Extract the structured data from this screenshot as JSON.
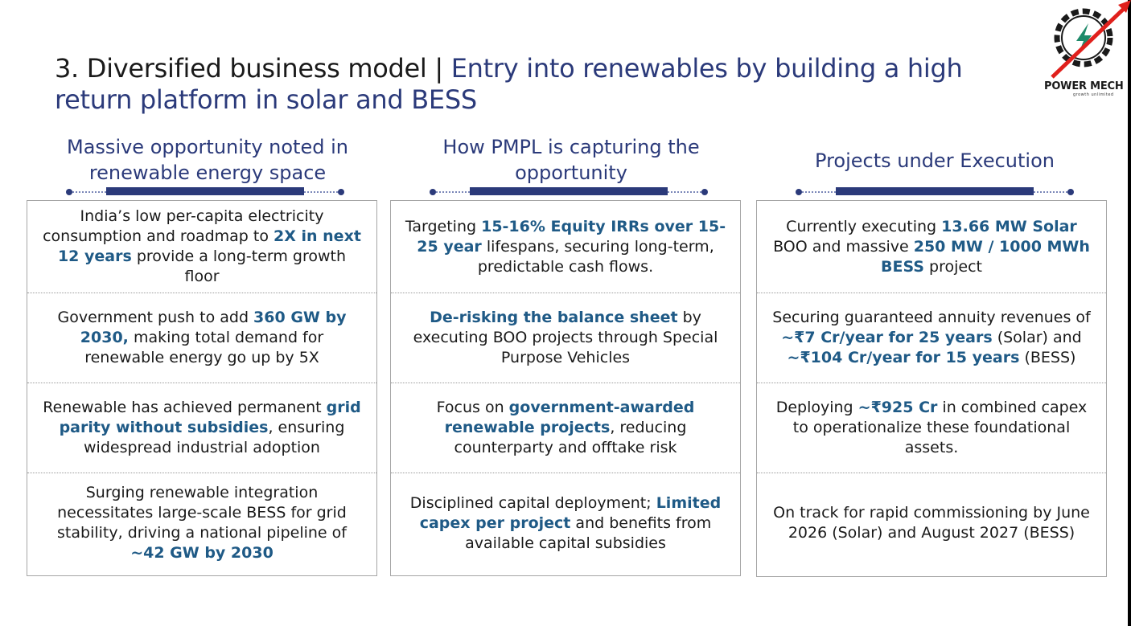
{
  "title": {
    "prefix": "3. Diversified business model",
    "separator": " | ",
    "main": "Entry into renewables by building a high return platform in solar and BESS"
  },
  "logo": {
    "icon": "gear-lightning-arrow-icon",
    "name": "POWER MECH",
    "tagline": "growth unlimited",
    "colors": {
      "gear": "#1a1a1a",
      "bolt": "#1f8a6a",
      "arrow": "#e0201c"
    }
  },
  "colors": {
    "accent": "#2b3a7a",
    "highlight": "#1f5a86",
    "border": "#a6a6a6"
  },
  "columns": [
    {
      "heading": "Massive opportunity noted in renewable energy space",
      "items": [
        [
          {
            "t": "India’s low per-capita electricity consumption and roadmap to "
          },
          {
            "t": "2X in next 12 years",
            "h": true
          },
          {
            "t": " provide a long-term growth floor"
          }
        ],
        [
          {
            "t": "Government push to add "
          },
          {
            "t": "360 GW by 2030,",
            "h": true
          },
          {
            "t": " making total demand for renewable energy go up by 5X"
          }
        ],
        [
          {
            "t": "Renewable has achieved permanent "
          },
          {
            "t": "grid parity without subsidies",
            "h": true
          },
          {
            "t": ", ensuring widespread industrial adoption"
          }
        ],
        [
          {
            "t": "Surging renewable integration necessitates large-scale BESS for grid stability, driving a national pipeline of "
          },
          {
            "t": "~42 GW by 2030",
            "h": true
          }
        ]
      ]
    },
    {
      "heading": "How PMPL is capturing the opportunity",
      "items": [
        [
          {
            "t": "Targeting "
          },
          {
            "t": "15-16% Equity IRRs over 15-25 year",
            "h": true
          },
          {
            "t": " lifespans, securing long-term, predictable cash flows."
          }
        ],
        [
          {
            "t": "De-risking the balance sheet",
            "h": true
          },
          {
            "t": " by executing BOO projects through Special Purpose Vehicles"
          }
        ],
        [
          {
            "t": "Focus on "
          },
          {
            "t": "government-awarded renewable projects",
            "h": true
          },
          {
            "t": ", reducing counterparty and offtake risk"
          }
        ],
        [
          {
            "t": "Disciplined capital deployment; "
          },
          {
            "t": "Limited capex per project",
            "h": true
          },
          {
            "t": " and benefits from available capital subsidies"
          }
        ]
      ]
    },
    {
      "heading": "Projects under Execution",
      "items": [
        [
          {
            "t": "Currently executing "
          },
          {
            "t": "13.66 MW Solar",
            "h": true
          },
          {
            "t": " BOO and massive "
          },
          {
            "t": "250 MW / 1000 MWh BESS",
            "h": true
          },
          {
            "t": " project"
          }
        ],
        [
          {
            "t": "Securing guaranteed annuity revenues of "
          },
          {
            "t": "~₹7 Cr/year for 25 years",
            "h": true
          },
          {
            "t": " (Solar) and "
          },
          {
            "t": "~₹104 Cr/year for 15 years",
            "h": true
          },
          {
            "t": " (BESS)"
          }
        ],
        [
          {
            "t": "Deploying  "
          },
          {
            "t": "~₹925 Cr",
            "h": true
          },
          {
            "t": " in combined capex to operationalize these foundational assets."
          }
        ],
        [
          {
            "t": "On track for rapid commissioning by June 2026 (Solar) and August 2027 (BESS)"
          }
        ]
      ]
    }
  ]
}
